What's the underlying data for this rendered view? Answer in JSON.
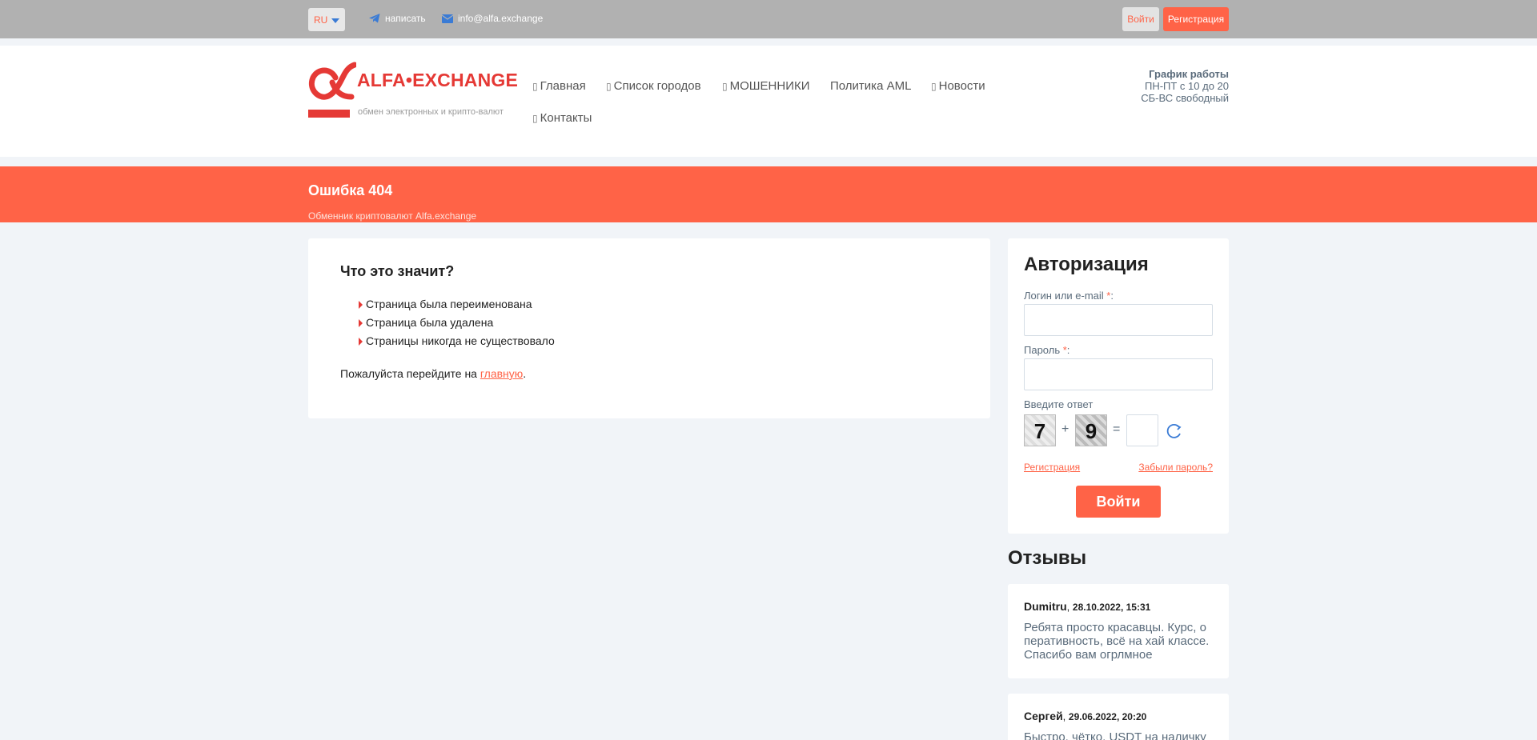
{
  "topbar": {
    "lang": "RU",
    "write_label": "написать",
    "email": "info@alfa.exchange",
    "login_label": "Войти",
    "register_label": "Регистрация"
  },
  "header": {
    "logo_word": "ALFA•EXCHANGE",
    "logo_sub": "обмен электронных и крипто-валют",
    "nav": [
      {
        "label": "Главная",
        "icon": "home-icon"
      },
      {
        "label": "Список городов",
        "icon": "list-icon"
      },
      {
        "label": "МОШЕННИКИ",
        "icon": "warning-icon"
      },
      {
        "label": "Политика AML",
        "icon": ""
      },
      {
        "label": "Новости",
        "icon": "news-icon"
      },
      {
        "label": "Контакты",
        "icon": "contacts-icon"
      }
    ],
    "schedule": {
      "title": "График работы",
      "line1": "ПН-ПТ с 10 до 20",
      "line2": "СБ-ВС свободный"
    }
  },
  "banner": {
    "title": "Ошибка 404",
    "crumb": "Обменник криптовалют Alfa.exchange"
  },
  "main": {
    "heading": "Что это значит?",
    "reasons": [
      "Страница была переименована",
      "Страница была удалена",
      "Страницы никогда не существовало"
    ],
    "goto_prefix": "Пожалуйста перейдите на ",
    "goto_link": "главную",
    "goto_suffix": "."
  },
  "auth": {
    "title": "Авторизация",
    "login_label": "Логин или e-mail",
    "password_label": "Пароль",
    "required_mark": "*",
    "colon": ":",
    "captcha_label": "Введите ответ",
    "captcha_a": "7",
    "captcha_op": "+",
    "captcha_b": "9",
    "captcha_eq": "=",
    "register_link": "Регистрация",
    "forgot_link": "Забыли пароль?",
    "submit": "Войти"
  },
  "reviews": {
    "title": "Отзывы",
    "items": [
      {
        "author": "Dumitru",
        "date": "28.10.2022, 15:31",
        "text": "Ребята просто красавцы. Курс, о перативность, всё на хай классе. Спасибо вам огрлмное"
      },
      {
        "author": "Сергей",
        "date": "29.06.2022, 20:20",
        "text": "Быстро, чётко, USDT на наличку"
      }
    ]
  },
  "colors": {
    "accent": "#ff6347",
    "brand_red": "#e53935",
    "topbar": "#b1b1b1",
    "page_bg": "#f1f4f8"
  }
}
